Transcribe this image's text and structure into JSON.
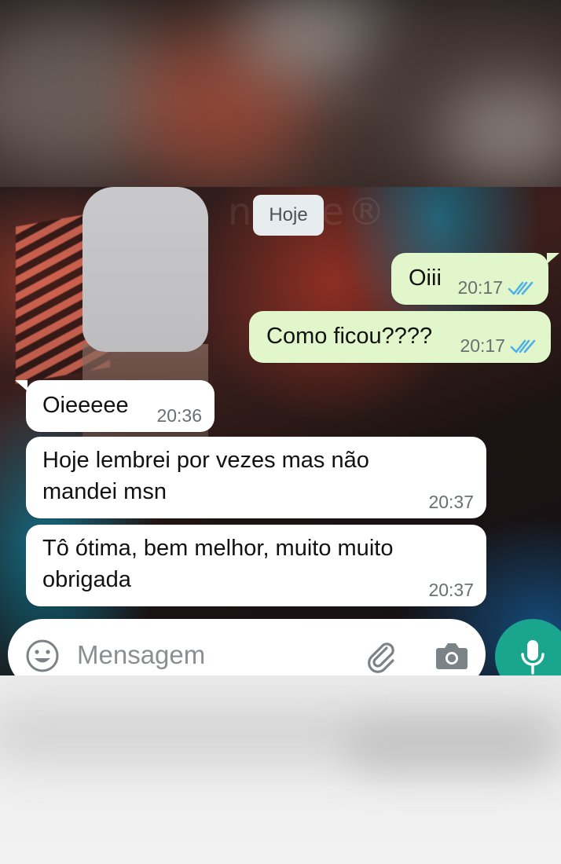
{
  "chat": {
    "date_label": "Hoje",
    "messages": [
      {
        "direction": "out",
        "text": "Oiii",
        "time": "20:17",
        "status": "read"
      },
      {
        "direction": "out",
        "text": "Como ficou????",
        "time": "20:17",
        "status": "read"
      },
      {
        "direction": "in",
        "text": "Oieeeee",
        "time": "20:36"
      },
      {
        "direction": "in",
        "text": "Hoje lembrei por vezes mas não\nmandei msn",
        "time": "20:37"
      },
      {
        "direction": "in",
        "text": "Tô ótima,  bem melhor, muito muito\nobrigada",
        "time": "20:37"
      }
    ]
  },
  "input": {
    "placeholder": "Mensagem",
    "icons": [
      "emoji-icon",
      "attach-icon",
      "camera-icon",
      "mic-icon"
    ]
  },
  "colors": {
    "outgoing_bubble": "#e1f7cb",
    "incoming_bubble": "#ffffff",
    "read_ticks": "#4fb0e8",
    "mic_button": "#1aa58f"
  }
}
